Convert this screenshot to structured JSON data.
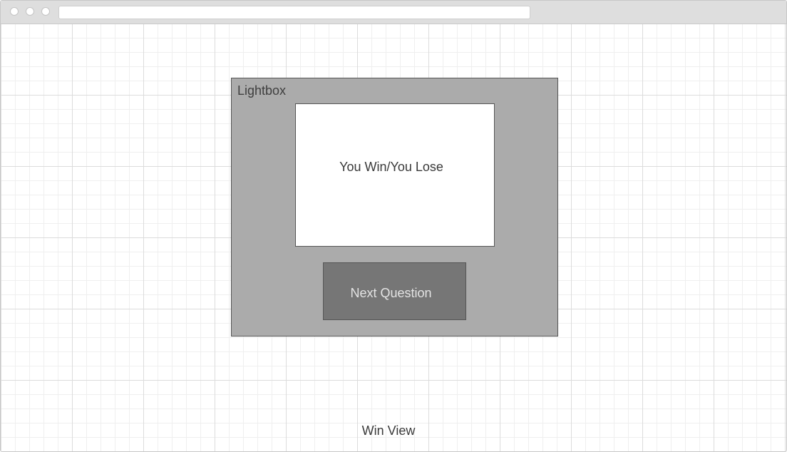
{
  "browser": {
    "address_value": ""
  },
  "lightbox": {
    "label": "Lightbox",
    "result_text": "You Win/You Lose",
    "next_button_label": "Next Question"
  },
  "caption": "Win View"
}
